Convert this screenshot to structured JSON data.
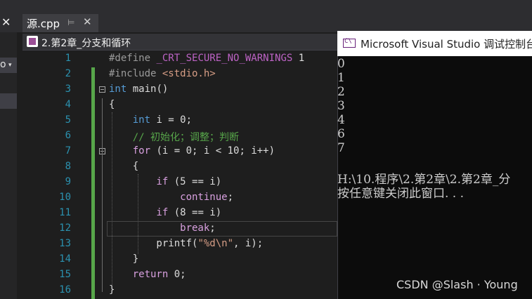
{
  "tabs": {
    "left_close": "✕",
    "doc_tab_label": "源.cpp",
    "pin": "⊨",
    "close": "✕"
  },
  "sidebar": {
    "item_text": "o",
    "chevron": "▾"
  },
  "navbar": {
    "project_label": "2.第2章_分支和循环"
  },
  "editor": {
    "line_numbers": [
      "1",
      "2",
      "3",
      "4",
      "5",
      "6",
      "7",
      "8",
      "9",
      "10",
      "11",
      "12",
      "13",
      "14",
      "15",
      "16"
    ],
    "lines": [
      [
        {
          "c": "pp",
          "t": "#define "
        },
        {
          "c": "mac",
          "t": "_CRT_SECURE_NO_WARNINGS"
        },
        {
          "c": "tx",
          "t": " 1"
        }
      ],
      [
        {
          "c": "pp",
          "t": "#include "
        },
        {
          "c": "str",
          "t": "<stdio.h>"
        }
      ],
      [
        {
          "c": "kw",
          "t": "int"
        },
        {
          "c": "tx",
          "t": " main()"
        }
      ],
      [
        {
          "c": "tx",
          "t": "{"
        }
      ],
      [
        {
          "c": "tx",
          "t": "    "
        },
        {
          "c": "kw",
          "t": "int"
        },
        {
          "c": "tx",
          "t": " i = 0;"
        }
      ],
      [
        {
          "c": "cm",
          "t": "    // 初始化；调整；判断"
        }
      ],
      [
        {
          "c": "purple",
          "t": "    for"
        },
        {
          "c": "tx",
          "t": " (i = 0; i < 10; i++)"
        }
      ],
      [
        {
          "c": "tx",
          "t": "    {"
        }
      ],
      [
        {
          "c": "purple",
          "t": "        if"
        },
        {
          "c": "tx",
          "t": " (5 == i)"
        }
      ],
      [
        {
          "c": "purple",
          "t": "            continue"
        },
        {
          "c": "tx",
          "t": ";"
        }
      ],
      [
        {
          "c": "purple",
          "t": "        if"
        },
        {
          "c": "tx",
          "t": " (8 == i)"
        }
      ],
      [
        {
          "c": "purple",
          "t": "            break"
        },
        {
          "c": "tx",
          "t": ";"
        }
      ],
      [
        {
          "c": "tx",
          "t": "        printf("
        },
        {
          "c": "str",
          "t": "\"%d\\n\""
        },
        {
          "c": "tx",
          "t": ", i);"
        }
      ],
      [
        {
          "c": "tx",
          "t": "    }"
        }
      ],
      [
        {
          "c": "purple",
          "t": "    return"
        },
        {
          "c": "tx",
          "t": " 0;"
        }
      ],
      [
        {
          "c": "tx",
          "t": "}"
        }
      ]
    ]
  },
  "console": {
    "title": "Microsoft Visual Studio 调试控制台",
    "output": [
      "0",
      "1",
      "2",
      "3",
      "4",
      "6",
      "7",
      "",
      "H:\\10.程序\\2.第2章\\2.第2章_分",
      "按任意键关闭此窗口. . ."
    ]
  },
  "watermark": "CSDN @Slash · Young",
  "colors": {
    "accent": "#007acc",
    "keyword": "#569cd6",
    "control": "#d8a0df",
    "string": "#d69d85",
    "comment": "#57a64a",
    "line_number": "#2b91af"
  }
}
